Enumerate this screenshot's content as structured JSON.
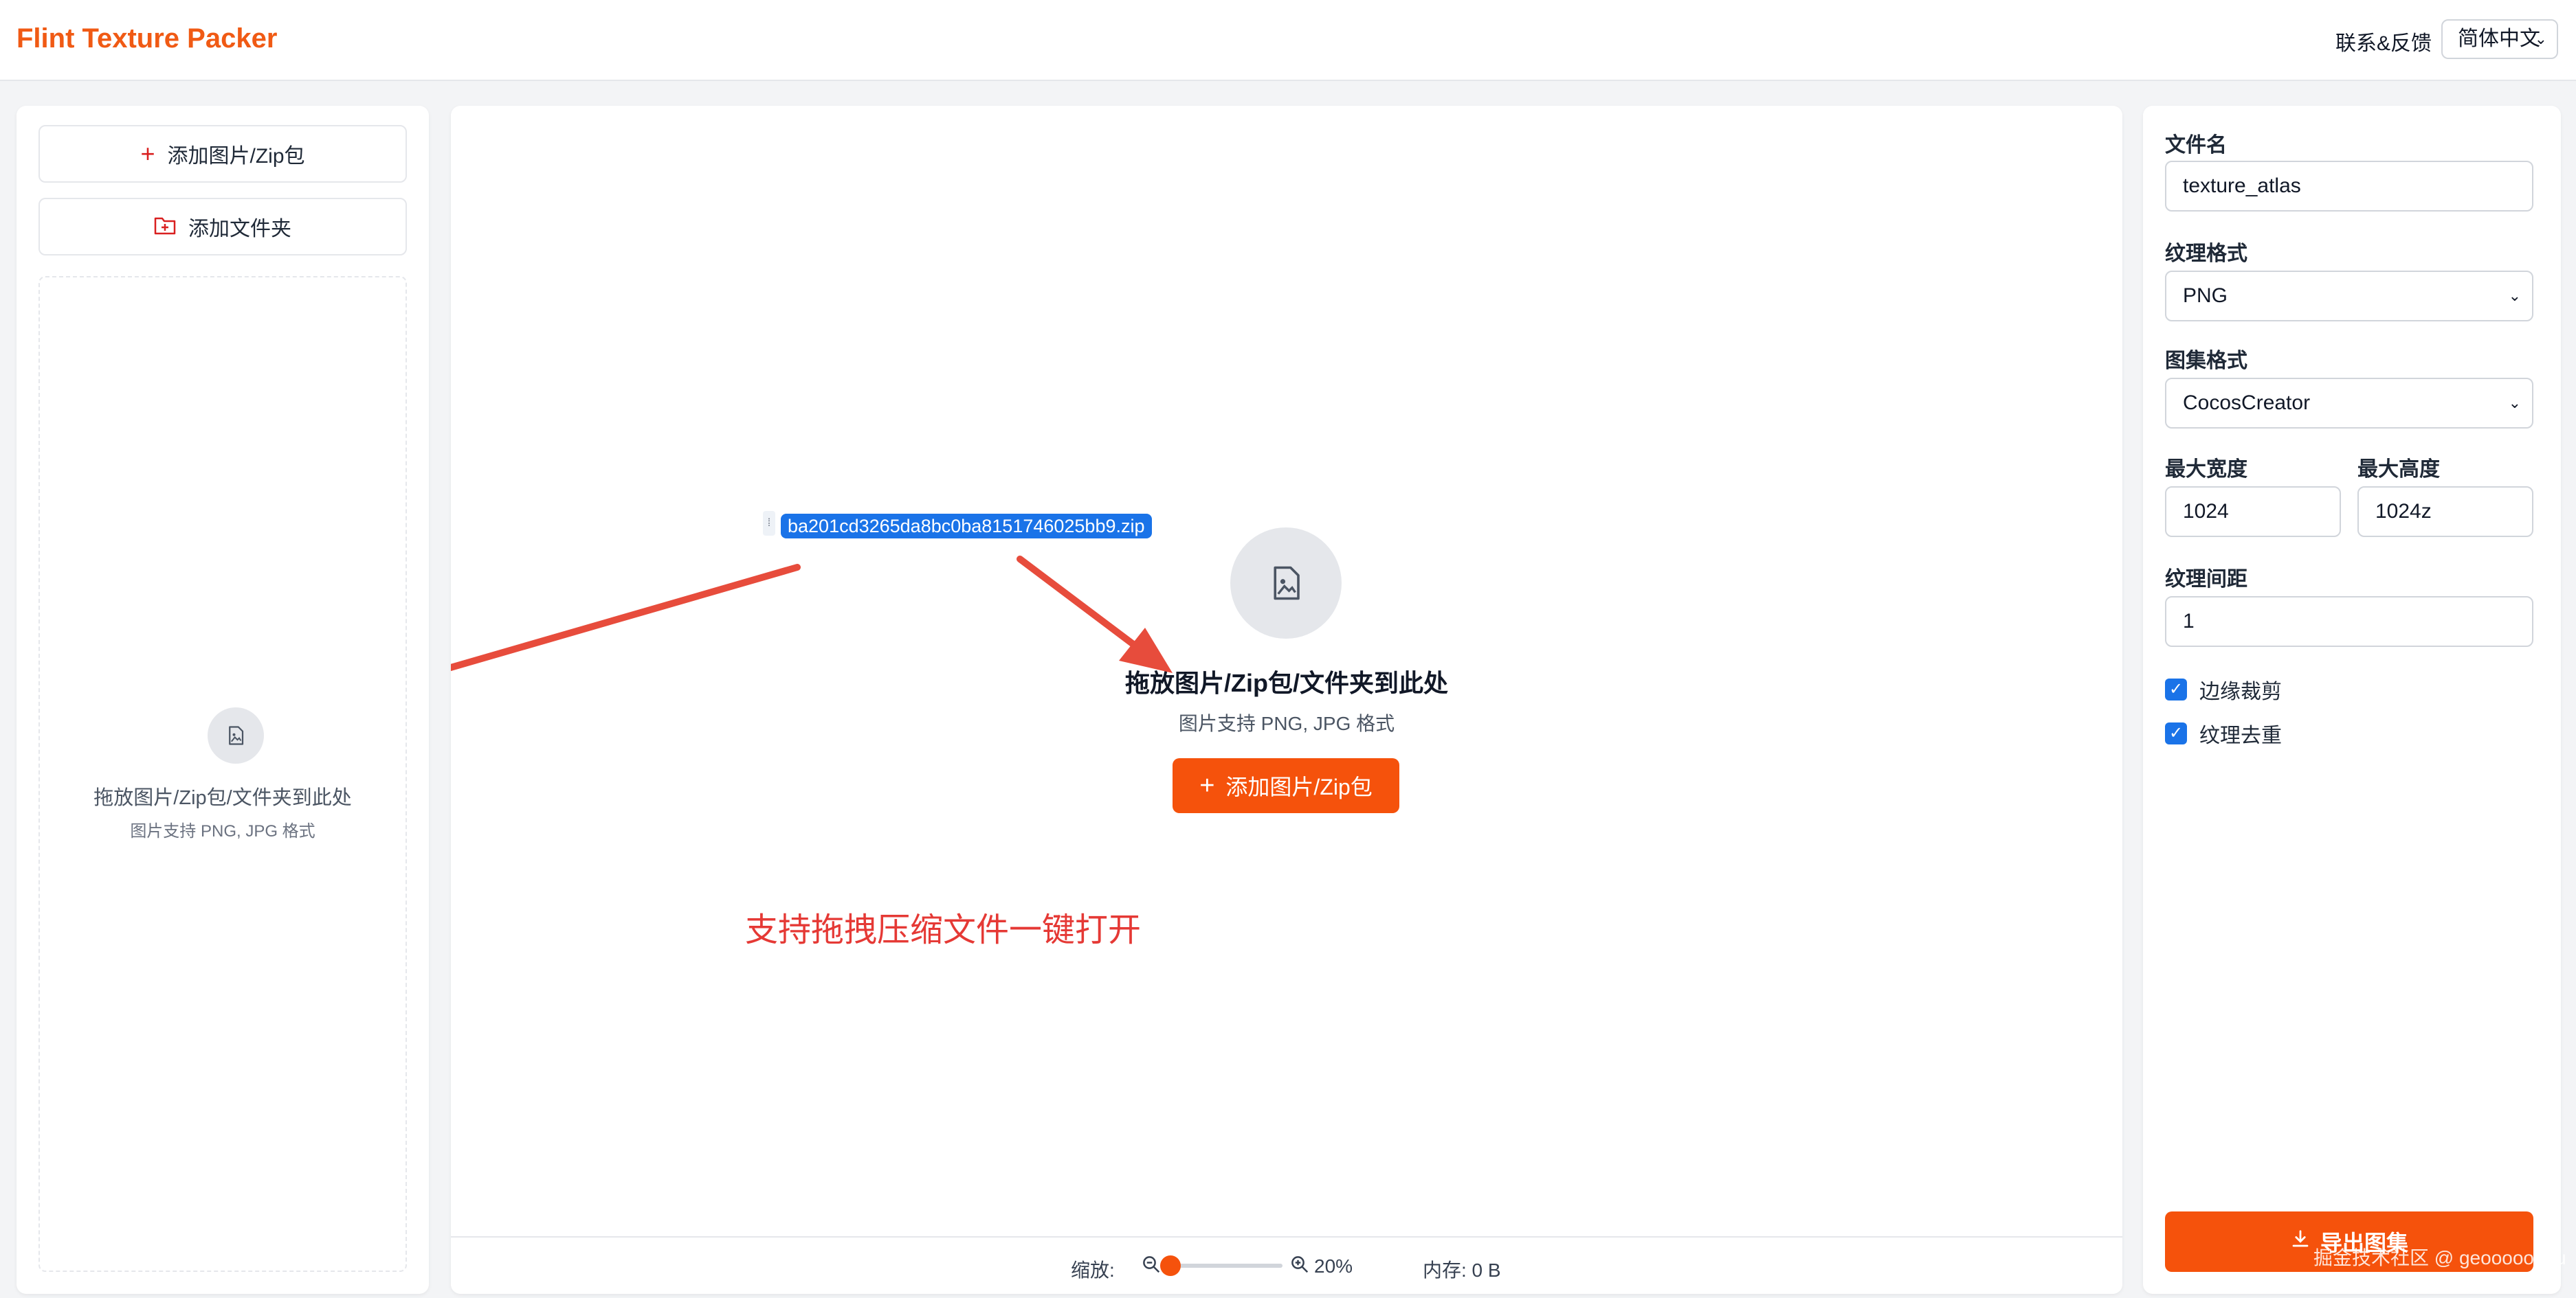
{
  "header": {
    "app_title": "Flint Texture Packer",
    "contact_label": "联系&反馈",
    "language_selected": "简体中文"
  },
  "left_panel": {
    "add_images_label": "添加图片/Zip包",
    "add_folder_label": "添加文件夹",
    "dropzone_title": "拖放图片/Zip包/文件夹到此处",
    "dropzone_subtitle": "图片支持 PNG, JPG 格式"
  },
  "canvas": {
    "dropzone_title": "拖放图片/Zip包/文件夹到此处",
    "dropzone_subtitle": "图片支持 PNG, JPG 格式",
    "add_button_label": "添加图片/Zip包",
    "dragged_file_name": "ba201cd3265da8bc0ba8151746025bb9.zip",
    "annotation_text": "支持拖拽压缩文件一键打开"
  },
  "statusbar": {
    "zoom_label": "缩放:",
    "zoom_value": "20%",
    "zoom_fraction": 0.0,
    "memory_text": "内存: 0 B"
  },
  "settings": {
    "filename_label": "文件名",
    "filename_value": "texture_atlas",
    "texture_format_label": "纹理格式",
    "texture_format_value": "PNG",
    "atlas_format_label": "图集格式",
    "atlas_format_value": "CocosCreator",
    "max_width_label": "最大宽度",
    "max_width_value": "1024",
    "max_height_label": "最大高度",
    "max_height_value": "1024z",
    "padding_label": "纹理间距",
    "padding_value": "1",
    "trim_label": "边缘裁剪",
    "trim_checked": true,
    "dedupe_label": "纹理去重",
    "dedupe_checked": true,
    "export_label": "导出图集"
  },
  "watermark": "掘金技术社区 @ geoooooohu",
  "colors": {
    "accent": "#f5520c",
    "title": "#f05a14",
    "annotation": "#e53935",
    "checkbox": "#1a73e8"
  },
  "icons": {
    "add": "plus-icon",
    "folder": "folder-plus-icon",
    "image": "image-file-icon",
    "zoom_out": "zoom-out-icon",
    "zoom_in": "zoom-in-icon",
    "download": "download-icon"
  }
}
